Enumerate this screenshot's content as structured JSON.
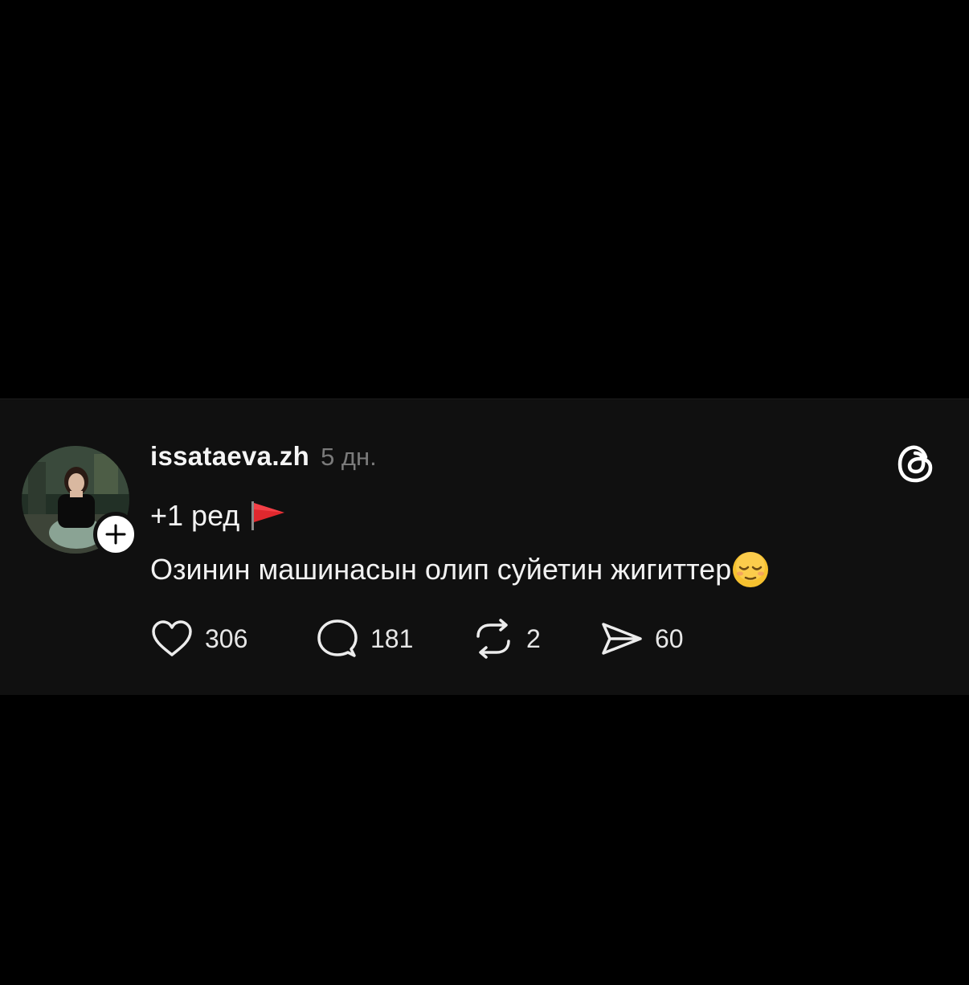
{
  "post": {
    "username": "issataeva.zh",
    "time_ago": "5 дн.",
    "text_line1": "+1 ред",
    "text_line2": "Озинин машинасын олип суйетин жигиттер",
    "icons": {
      "flag": "red-flag-icon",
      "emoji": "relieved-face-emoji-icon",
      "logo": "threads-logo-icon",
      "follow": "plus-icon"
    },
    "actions": {
      "likes": "306",
      "replies": "181",
      "reposts": "2",
      "shares": "60"
    }
  },
  "colors": {
    "background": "#000000",
    "card": "#101010",
    "text": "#f2f2f2",
    "muted": "#7a7a7a",
    "flag": "#e0282e",
    "emoji": "#f6c12f"
  }
}
